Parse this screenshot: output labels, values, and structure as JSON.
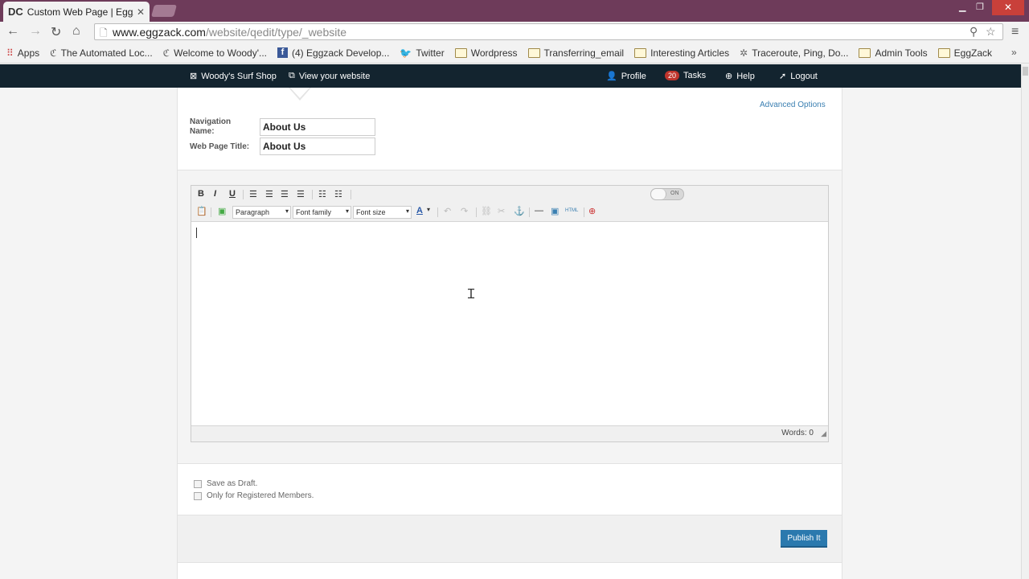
{
  "browser": {
    "tab_title": "Custom Web Page | EggZ",
    "tab_favicon": "DC",
    "url_host": "www.eggzack.com",
    "url_path": "/website/qedit/type/_website",
    "bookmarks": [
      {
        "label": "Apps",
        "icon": "apps-grid-icon"
      },
      {
        "label": "The Automated Loc...",
        "icon": "eggzack-logo-icon"
      },
      {
        "label": "Welcome to Woody'...",
        "icon": "eggzack-logo-icon"
      },
      {
        "label": "(4) Eggzack Develop...",
        "icon": "facebook-icon"
      },
      {
        "label": "Twitter",
        "icon": "twitter-icon"
      },
      {
        "label": "Wordpress",
        "icon": "folder-icon"
      },
      {
        "label": "Transferring_email",
        "icon": "folder-icon"
      },
      {
        "label": "Interesting Articles",
        "icon": "folder-icon"
      },
      {
        "label": "Traceroute, Ping, Do...",
        "icon": "star-icon"
      },
      {
        "label": "Admin Tools",
        "icon": "folder-icon"
      },
      {
        "label": "EggZack",
        "icon": "folder-icon"
      }
    ]
  },
  "sitenav": {
    "site_name": "Woody's Surf Shop",
    "view_website": "View your website",
    "profile": "Profile",
    "tasks_count": "20",
    "tasks": "Tasks",
    "help": "Help",
    "logout": "Logout"
  },
  "form": {
    "advanced_options": "Advanced Options",
    "nav_name_label_1": "Navigation",
    "nav_name_label_2": "Name:",
    "nav_name_value": "About Us",
    "page_title_label": "Web Page Title:",
    "page_title_value": "About Us"
  },
  "editor": {
    "bold": "B",
    "italic": "I",
    "underline": "U",
    "paragraph": "Paragraph",
    "font_family": "Font family",
    "font_size": "Font size",
    "toggle": "ON",
    "words": "Words: 0"
  },
  "options": {
    "save_draft": "Save as Draft.",
    "registered_only": "Only for Registered Members."
  },
  "publish_label": "Publish It"
}
